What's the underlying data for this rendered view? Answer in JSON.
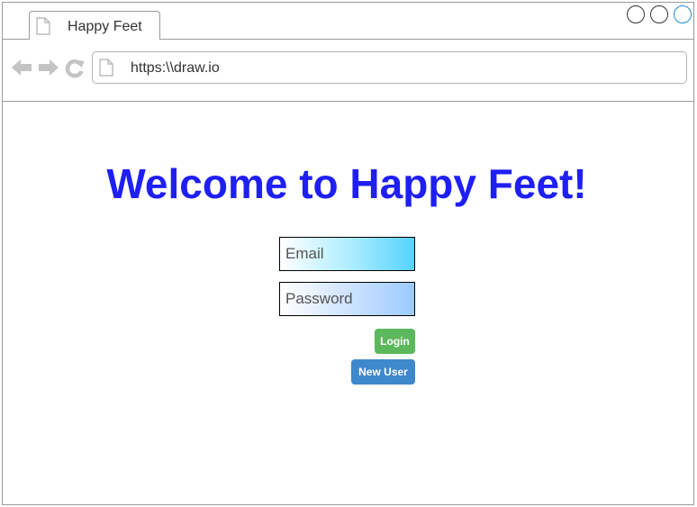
{
  "browser": {
    "tab_title": "Happy Feet",
    "url": "https:\\\\draw.io",
    "accent_color": "#1e90d8"
  },
  "icons": {
    "tab": "page-icon",
    "back": "back-arrow-icon",
    "forward": "forward-arrow-icon",
    "reload": "reload-icon",
    "address": "page-icon"
  },
  "main": {
    "heading": "Welcome to Happy Feet!",
    "heading_color": "#1f1ff5",
    "email_placeholder": "Email",
    "password_placeholder": "Password",
    "login_label": "Login",
    "login_color": "#5cb85c",
    "new_user_label": "New User",
    "new_user_color": "#3e88cc"
  }
}
